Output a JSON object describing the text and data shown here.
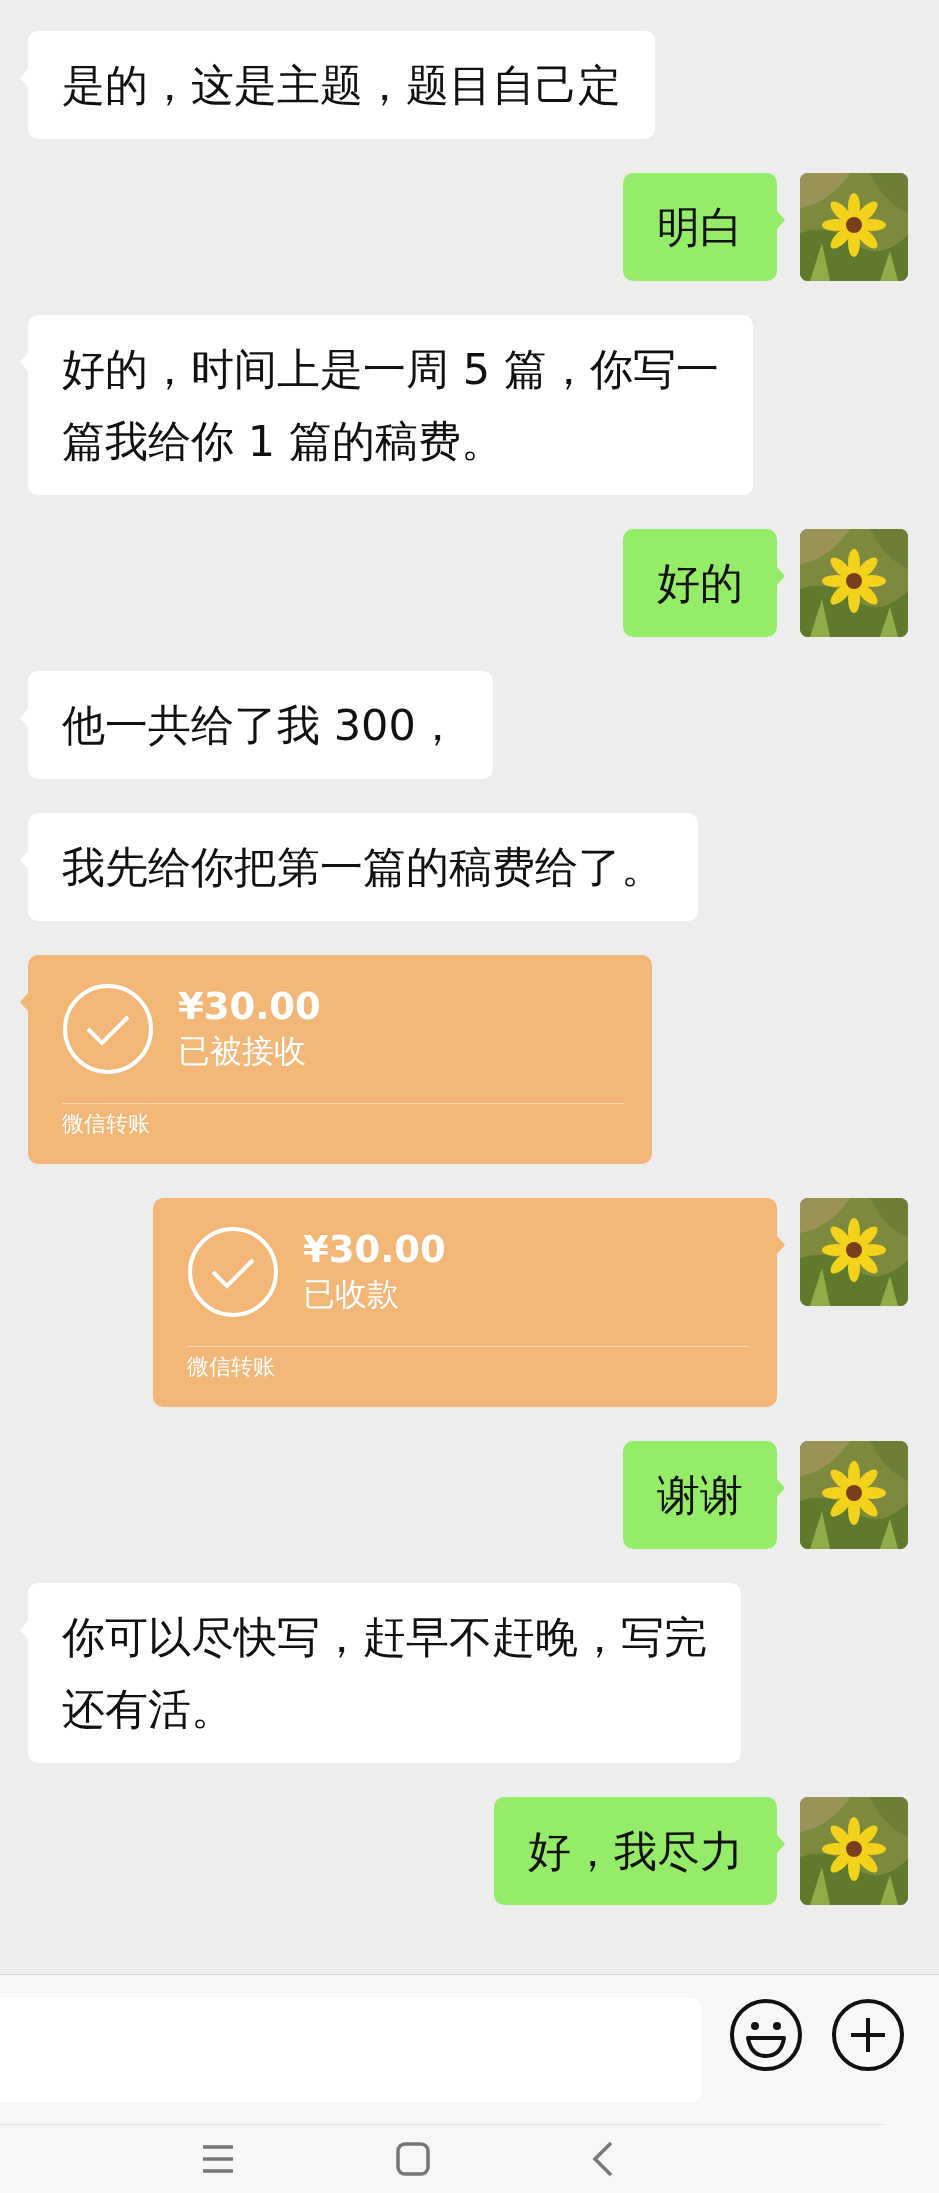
{
  "messages": [
    {
      "outgoing": false,
      "kind": "text",
      "lines": [
        "是的，这是主题，题目自己定"
      ]
    },
    {
      "outgoing": true,
      "kind": "text",
      "lines": [
        "明白"
      ]
    },
    {
      "outgoing": false,
      "kind": "text",
      "lines": [
        "好的，时间上是一周 5 篇，你写一",
        "篇我给你 1 篇的稿费。"
      ]
    },
    {
      "outgoing": true,
      "kind": "text",
      "lines": [
        "好的"
      ]
    },
    {
      "outgoing": false,
      "kind": "text",
      "lines": [
        "他一共给了我 300，"
      ]
    },
    {
      "outgoing": false,
      "kind": "text",
      "lines": [
        "我先给你把第一篇的稿费给了。"
      ]
    },
    {
      "outgoing": false,
      "kind": "transfer",
      "amount": "¥30.00",
      "status": "已被接收",
      "footer": "微信转账"
    },
    {
      "outgoing": true,
      "kind": "transfer",
      "amount": "¥30.00",
      "status": "已收款",
      "footer": "微信转账"
    },
    {
      "outgoing": true,
      "kind": "text",
      "lines": [
        "谢谢"
      ]
    },
    {
      "outgoing": false,
      "kind": "text",
      "lines": [
        "你可以尽快写，赶早不赶晚，写完",
        "还有活。"
      ]
    },
    {
      "outgoing": true,
      "kind": "text",
      "lines": [
        "好，我尽力"
      ]
    }
  ]
}
